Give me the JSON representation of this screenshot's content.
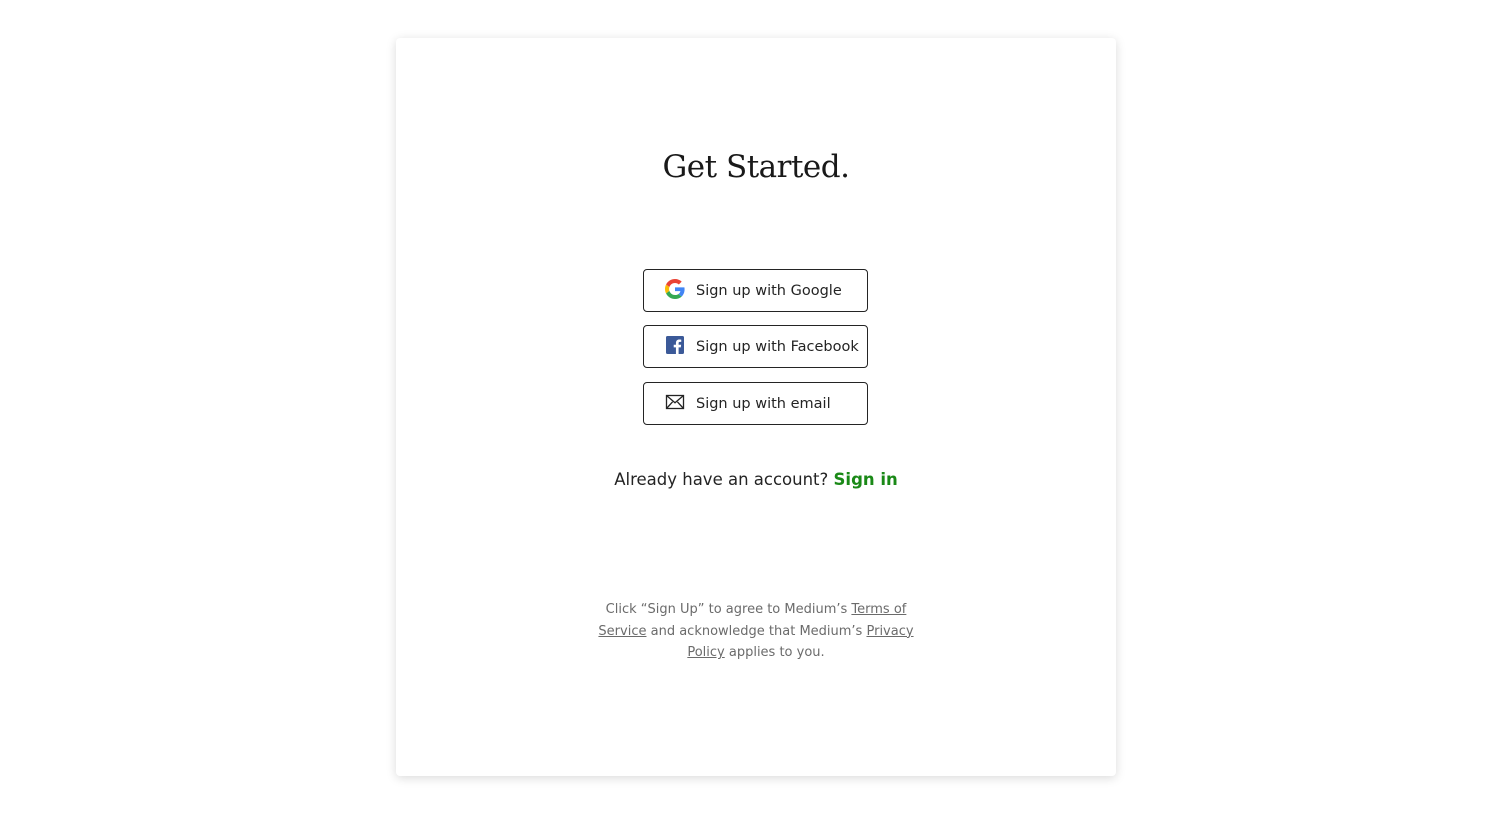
{
  "signup": {
    "title": "Get Started.",
    "buttons": [
      {
        "label": "Sign up with Google",
        "icon": "google-icon"
      },
      {
        "label": "Sign up with Facebook",
        "icon": "facebook-icon"
      },
      {
        "label": "Sign up with email",
        "icon": "email-icon"
      }
    ],
    "already_text": "Already have an account?",
    "sign_in_link": "Sign in",
    "legal": {
      "line1_prefix": "Click “Sign Up” to agree to Medium’s",
      "terms_link": "Terms of Service",
      "line2_prefix": "and acknowledge that Medium’s",
      "privacy_link": "Privacy Policy",
      "line2_suffix": "applies to you."
    }
  },
  "colors": {
    "accent_green": "#1a8917",
    "text_primary": "#242424",
    "text_muted": "#6b6b6b",
    "facebook_blue": "#3b5998"
  }
}
